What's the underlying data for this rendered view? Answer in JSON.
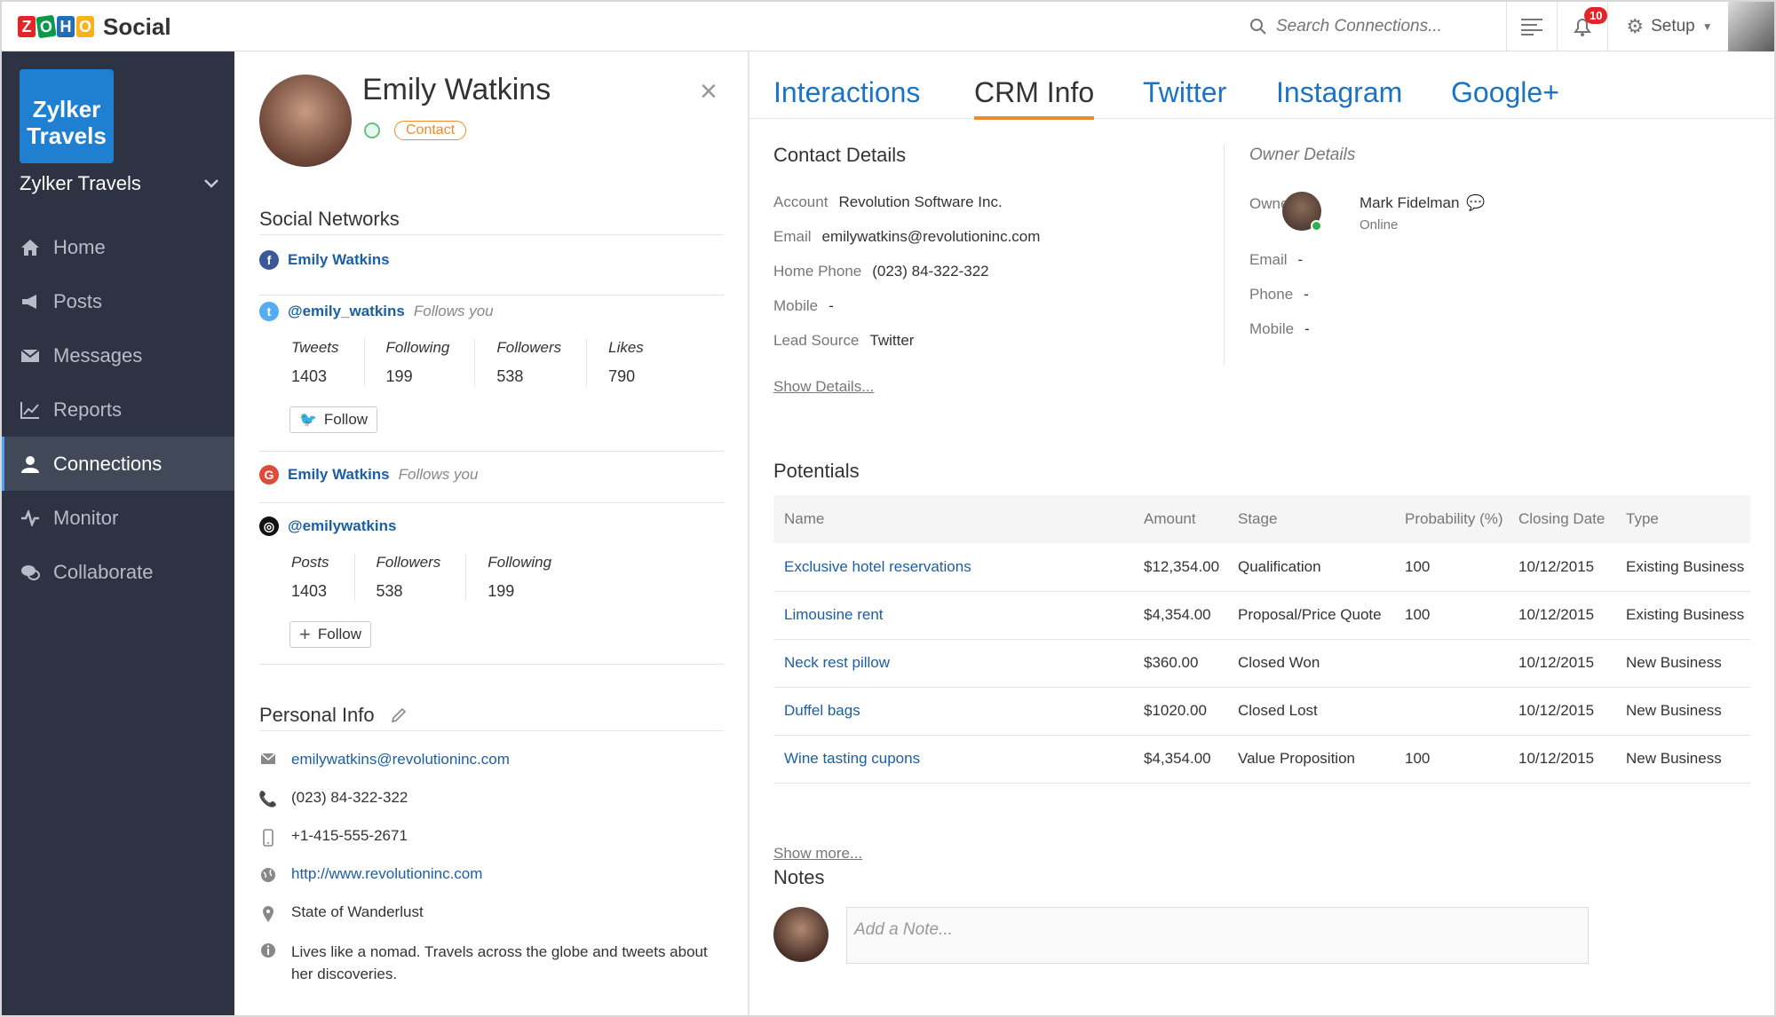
{
  "topbar": {
    "logo_letters": [
      "Z",
      "O",
      "H",
      "O"
    ],
    "app_name": "Social",
    "search_placeholder": "Search Connections...",
    "notification_count": "10",
    "setup_label": "Setup"
  },
  "sidebar": {
    "brand_logo_text": "Zylker Travels",
    "brand_name": "Zylker Travels",
    "items": [
      {
        "label": "Home",
        "icon": "home-icon"
      },
      {
        "label": "Posts",
        "icon": "megaphone-icon"
      },
      {
        "label": "Messages",
        "icon": "envelope-icon"
      },
      {
        "label": "Reports",
        "icon": "chart-icon"
      },
      {
        "label": "Connections",
        "icon": "user-icon",
        "active": true
      },
      {
        "label": "Monitor",
        "icon": "pulse-icon"
      },
      {
        "label": "Collaborate",
        "icon": "chat-icon"
      }
    ]
  },
  "profile": {
    "name": "Emily Watkins",
    "tag": "Contact"
  },
  "social": {
    "title": "Social Networks",
    "facebook": {
      "name": "Emily Watkins"
    },
    "twitter": {
      "handle": "@emily_watkins",
      "follows_you": "Follows you",
      "stats": [
        {
          "label": "Tweets",
          "value": "1403"
        },
        {
          "label": "Following",
          "value": "199"
        },
        {
          "label": "Followers",
          "value": "538"
        },
        {
          "label": "Likes",
          "value": "790"
        }
      ],
      "follow_label": "Follow"
    },
    "google": {
      "name": "Emily Watkins",
      "follows_you": "Follows you"
    },
    "instagram": {
      "handle": "@emilywatkins",
      "stats": [
        {
          "label": "Posts",
          "value": "1403"
        },
        {
          "label": "Followers",
          "value": "538"
        },
        {
          "label": "Following",
          "value": "199"
        }
      ],
      "follow_label": "Follow"
    }
  },
  "personal": {
    "title": "Personal Info",
    "email": "emilywatkins@revolutioninc.com",
    "phone": "(023) 84-322-322",
    "mobile": "+1-415-555-2671",
    "website": "http://www.revolutioninc.com",
    "location": "State of Wanderlust",
    "bio": "Lives like a nomad. Travels across the globe and tweets about her discoveries."
  },
  "tabs": [
    "Interactions",
    "CRM Info",
    "Twitter",
    "Instagram",
    "Google+"
  ],
  "contact_details": {
    "title": "Contact Details",
    "rows": [
      {
        "k": "Account",
        "v": "Revolution Software Inc."
      },
      {
        "k": "Email",
        "v": "emilywatkins@revolutioninc.com"
      },
      {
        "k": "Home Phone",
        "v": "(023) 84-322-322"
      },
      {
        "k": "Mobile",
        "v": "-"
      },
      {
        "k": "Lead Source",
        "v": "Twitter"
      }
    ],
    "show_details": "Show Details..."
  },
  "owner_details": {
    "title": "Owner Details",
    "owner_label": "Owner",
    "owner_name": "Mark Fidelman",
    "owner_status": "Online",
    "rows": [
      {
        "k": "Email",
        "v": "-"
      },
      {
        "k": "Phone",
        "v": "-"
      },
      {
        "k": "Mobile",
        "v": "-"
      }
    ]
  },
  "potentials": {
    "title": "Potentials",
    "headers": [
      "Name",
      "Amount",
      "Stage",
      "Probability (%)",
      "Closing Date",
      "Type"
    ],
    "rows": [
      [
        "Exclusive hotel reservations",
        "$12,354.00",
        "Qualification",
        "100",
        "10/12/2015",
        "Existing Business"
      ],
      [
        "Limousine rent",
        "$4,354.00",
        "Proposal/Price Quote",
        "100",
        "10/12/2015",
        "Existing Business"
      ],
      [
        "Neck rest pillow",
        "$360.00",
        "Closed Won",
        "",
        "10/12/2015",
        "New Business"
      ],
      [
        "Duffel bags",
        "$1020.00",
        "Closed Lost",
        "",
        "10/12/2015",
        "New Business"
      ],
      [
        "Wine tasting cupons",
        "$4,354.00",
        "Value Proposition",
        "100",
        "10/12/2015",
        "New Business"
      ]
    ],
    "show_more": "Show more..."
  },
  "notes": {
    "title": "Notes",
    "placeholder": "Add a Note..."
  }
}
